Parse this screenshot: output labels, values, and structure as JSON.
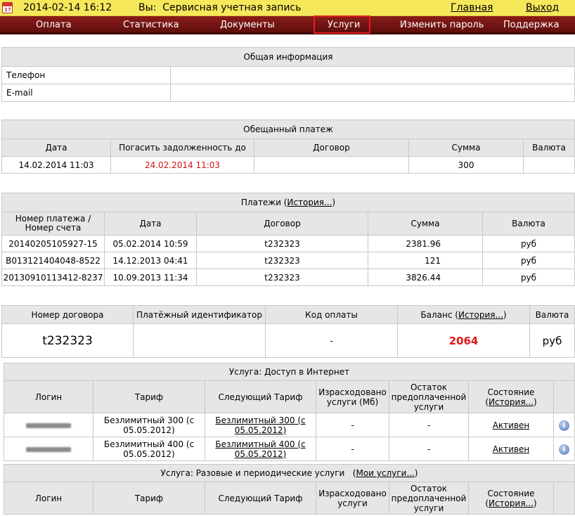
{
  "header": {
    "datetime": "2014-02-14 16:12",
    "user_label": "Вы:",
    "user_name": "Сервисная учетная запись",
    "home_link": "Главная",
    "logout_link": "Выход"
  },
  "nav": {
    "items": [
      "Оплата",
      "Статистика",
      "Документы",
      "Услуги",
      "Изменить пароль",
      "Поддержка"
    ],
    "active": "Услуги"
  },
  "general_info": {
    "title": "Общая информация",
    "rows": [
      {
        "label": "Телефон",
        "value": ""
      },
      {
        "label": "E-mail",
        "value": ""
      }
    ]
  },
  "promised_payment": {
    "title": "Обещанный платеж",
    "columns": [
      "Дата",
      "Погасить задолженность до",
      "Договор",
      "Сумма",
      "Валюта"
    ],
    "rows": [
      {
        "date": "14.02.2014 11:03",
        "due": "24.02.2014 11:03",
        "contract": "",
        "amount": "300",
        "currency": ""
      }
    ]
  },
  "payments": {
    "title": "Платежи",
    "history_link": "История...",
    "columns": [
      "Номер платежа / Номер счета",
      "Дата",
      "Договор",
      "Сумма",
      "Валюта"
    ],
    "rows": [
      {
        "number": "20140205105927-15",
        "date": "05.02.2014 10:59",
        "contract": "t232323",
        "amount": "2381.96",
        "currency": "руб"
      },
      {
        "number": "B013121404048-8522",
        "date": "14.12.2013 04:41",
        "contract": "t232323",
        "amount": "121",
        "currency": "руб"
      },
      {
        "number": "20130910113412-8237",
        "date": "10.09.2013 11:34",
        "contract": "t232323",
        "amount": "3826.44",
        "currency": "руб"
      }
    ]
  },
  "contract": {
    "columns": [
      "Номер договора",
      "Платёжный идентификатор",
      "Код оплаты",
      "Баланс",
      "Валюта"
    ],
    "balance_history_link": "История...",
    "number": "t232323",
    "payment_id": "",
    "payment_code": "-",
    "balance": "2064",
    "currency": "руб"
  },
  "service_internet": {
    "title": "Услуга: Доступ в Интернет",
    "columns": [
      "Логин",
      "Тариф",
      "Следующий Тариф",
      "Израсходовано услуги (Мб)",
      "Остаток предоплаченной услуги",
      "Состояние"
    ],
    "state_history_link": "История...",
    "rows": [
      {
        "tariff": "Безлимитный 300 (с 05.05.2012)",
        "next_tariff": "Безлимитный 300 (с 05.05.2012)",
        "used": "-",
        "rest": "-",
        "state": "Активен"
      },
      {
        "tariff": "Безлимитный 400 (с 05.05.2012)",
        "next_tariff": "Безлимитный 400 (с 05.05.2012)",
        "used": "-",
        "rest": "-",
        "state": "Активен"
      }
    ]
  },
  "service_periodic": {
    "title": "Услуга: Разовые и периодические услуги",
    "my_services_link": "Мои услуги...",
    "columns": [
      "Логин",
      "Тариф",
      "Следующий Тариф",
      "Израсходовано услуги",
      "Остаток предоплаченной услуги",
      "Состояние"
    ],
    "state_history_link": "История..."
  },
  "colors": {
    "topbar": "#f6e85b",
    "navbar": "#7a1614",
    "accent_red": "#d41212"
  }
}
